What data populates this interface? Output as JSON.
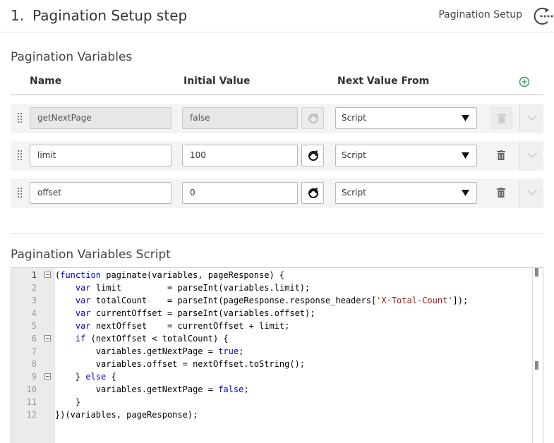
{
  "header": {
    "step_number": "1.",
    "title": "Pagination Setup step",
    "breadcrumb": "Pagination Setup",
    "icon": "loop-arrow-dots-icon"
  },
  "variables_section": {
    "title": "Pagination Variables",
    "columns": {
      "name": "Name",
      "initial_value": "Initial Value",
      "next_value_from": "Next Value From"
    },
    "add_icon": "plus-circle-icon",
    "rows": [
      {
        "name": "getNextPage",
        "initial_value": "false",
        "next_value_from": "Script",
        "disabled": true
      },
      {
        "name": "limit",
        "initial_value": "100",
        "next_value_from": "Script",
        "disabled": false
      },
      {
        "name": "offset",
        "initial_value": "0",
        "next_value_from": "Script",
        "disabled": false
      }
    ]
  },
  "script_section": {
    "title": "Pagination Variables Script",
    "lines": [
      "(function paginate(variables, pageResponse) {",
      "    var limit         = parseInt(variables.limit);",
      "    var totalCount    = parseInt(pageResponse.response_headers['X-Total-Count']);",
      "    var currentOffset = parseInt(variables.offset);",
      "    var nextOffset    = currentOffset + limit;",
      "    if (nextOffset < totalCount) {",
      "        variables.getNextPage = true;",
      "        variables.offset = nextOffset.toString();",
      "    } else {",
      "        variables.getNextPage = false;",
      "    }",
      "})(variables, pageResponse);"
    ],
    "line_numbers": [
      "1",
      "2",
      "3",
      "4",
      "5",
      "6",
      "7",
      "8",
      "9",
      "10",
      "11",
      "12"
    ],
    "active_line": 1,
    "fold_lines": [
      1,
      6,
      9
    ]
  },
  "colors": {
    "keyword": "#0000c8",
    "string": "#a31515",
    "add_icon": "#2e9e5b"
  }
}
